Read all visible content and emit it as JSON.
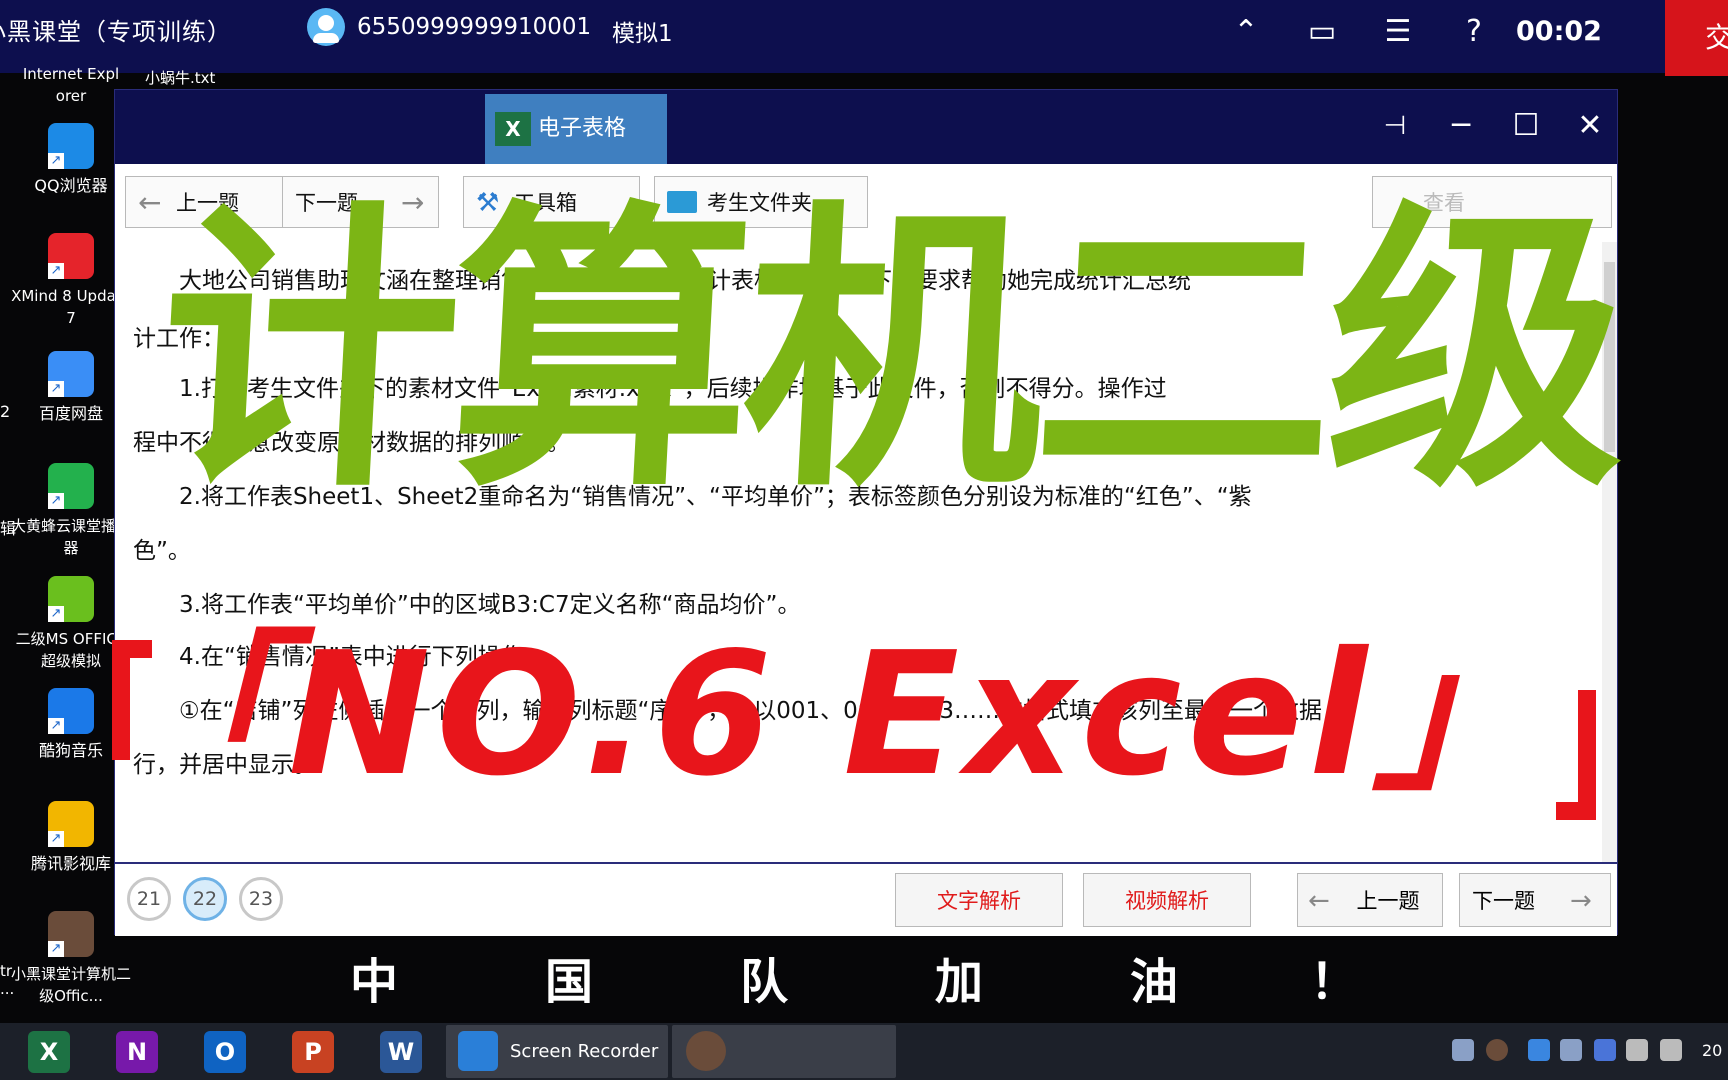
{
  "topbar": {
    "title": "小黑课堂（专项训练）",
    "user_id": "6550999999910001",
    "mode": "模拟1",
    "timer": "00:02",
    "submit_label": "交",
    "icon_collapse": "⌃",
    "icon_window": "▭",
    "icon_list": "☰",
    "icon_help": "?"
  },
  "desktop": {
    "partial_top": "Internet Expl\norer",
    "partial_top2": "小蜗牛.txt",
    "icons": [
      {
        "label": "QQ浏览器",
        "icon": "qq-browser-icon",
        "color": "#1c8ae6"
      },
      {
        "label": "XMind 8 Update 7",
        "icon": "xmind-icon",
        "color": "#e5242b"
      },
      {
        "label": "百度网盘",
        "icon": "baidu-pan-icon",
        "color": "#3a8ef6"
      },
      {
        "label": "大黄蜂云课堂播放器",
        "icon": "bumblebee-player-icon",
        "color": "#23b14d"
      },
      {
        "label": "二级MS OFFICE超级模拟",
        "icon": "ms-office-sim-icon",
        "color": "#6abf1e"
      },
      {
        "label": "酷狗音乐",
        "icon": "kugou-icon",
        "color": "#1b79e8"
      },
      {
        "label": "腾讯影视库",
        "icon": "tencent-video-icon",
        "color": "#f2b600"
      },
      {
        "label": "小黑课堂计算机二级Offic...",
        "icon": "xiaohei-ketang-icon",
        "color": "#6a4c3a"
      }
    ],
    "left_edge": [
      "2",
      "辑",
      "tr\n..."
    ]
  },
  "window": {
    "tab_label": "电子表格",
    "excel_mark": "X",
    "pin_icon": "⊣",
    "minimize_icon": "─",
    "maximize_icon": "☐",
    "close_icon": "✕"
  },
  "toolbar": {
    "prev": "上一题",
    "next": "下一题",
    "toolbox": "工具箱",
    "folder": "考生文件夹",
    "view_partial": "查看"
  },
  "content": {
    "lines": [
      "大地公司销售助理文涵在整理销售数据的销售情况统计表格时，根据下列要求帮助她完成统计汇总统",
      "计工作：",
      "1.打开考生文件夹下的素材文件“Excel素材.xlsx”，后续操作均基于此文件，否则不得分。操作过",
      "程中不得随意改变原素材数据的排列顺序。",
      "2.将工作表Sheet1、Sheet2重命名为“销售情况”、“平均单价”；表标签颜色分别设为标准的“红色”、“紫",
      "色”。",
      "3.将工作表“平均单价”中的区域B3:C7定义名称“商品均价”。",
      "4.在“销售情况”表中进行下列操作：",
      "①在“店铺”列左侧插入一个空列，输入列标题“序号”，并以001、002、003……的格式填充该列至最后一个数据",
      "行，并居中显示。"
    ]
  },
  "bottom": {
    "questions": [
      "21",
      "22",
      "23"
    ],
    "current": "22",
    "text_analysis": "文字解析",
    "video_analysis": "视频解析",
    "prev": "上一题",
    "next": "下一题"
  },
  "overlay": {
    "headline": "计算机二级",
    "subtitle": "「NO.6 Excel」",
    "cheer": [
      "中",
      "国",
      "队",
      "加",
      "油",
      "！"
    ]
  },
  "taskbar": {
    "apps": [
      {
        "letter": "X",
        "color": "#1d7244",
        "icon": "excel-taskbar-icon"
      },
      {
        "letter": "N",
        "color": "#7719aa",
        "icon": "onenote-taskbar-icon"
      },
      {
        "letter": "O",
        "color": "#0f63c2",
        "icon": "outlook-taskbar-icon"
      },
      {
        "letter": "P",
        "color": "#c84222",
        "icon": "powerpoint-taskbar-icon"
      },
      {
        "letter": "W",
        "color": "#2b5797",
        "icon": "word-taskbar-icon"
      }
    ],
    "screen_recorder": "Screen Recorder",
    "clock_partial": "20"
  },
  "colors": {
    "accent_green": "#7cb515",
    "accent_red": "#e8151b",
    "title_blue": "#0d0f4e"
  }
}
